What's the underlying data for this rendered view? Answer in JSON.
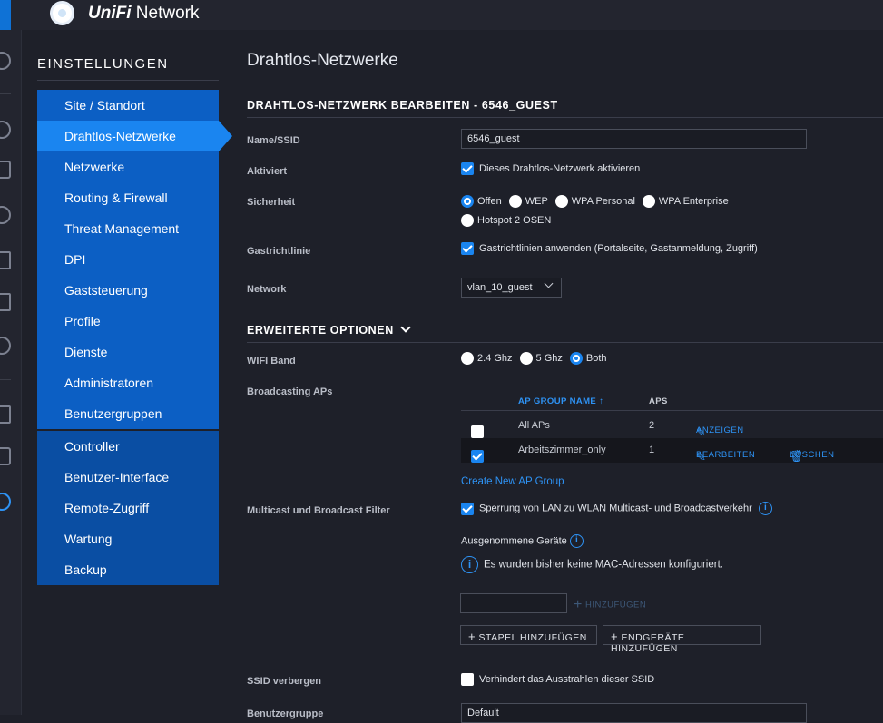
{
  "app": {
    "brand": "UniFi",
    "product": "Network"
  },
  "settings_nav": {
    "heading": "EINSTELLUNGEN",
    "items": [
      "Site / Standort",
      "Drahtlos-Netzwerke",
      "Netzwerke",
      "Routing & Firewall",
      "Threat Management",
      "DPI",
      "Gaststeuerung",
      "Profile",
      "Dienste",
      "Administratoren",
      "Benutzergruppen"
    ],
    "items2": [
      "Controller",
      "Benutzer-Interface",
      "Remote-Zugriff",
      "Wartung",
      "Backup"
    ],
    "active_index": 1
  },
  "page": {
    "title": "Drahtlos-Netzwerke",
    "section": "DRAHTLOS-NETZWERK BEARBEITEN - 6546_GUEST"
  },
  "form": {
    "ssid_label": "Name/SSID",
    "ssid_value": "6546_guest",
    "enabled_label": "Aktiviert",
    "enabled_text": "Dieses Drahtlos-Netzwerk aktivieren",
    "enabled": true,
    "security_label": "Sicherheit",
    "security_options": [
      "Offen",
      "WEP",
      "WPA Personal",
      "WPA Enterprise",
      "Hotspot 2 OSEN"
    ],
    "security_selected": "Offen",
    "guest_label": "Gastrichtlinie",
    "guest_text": "Gastrichtlinien anwenden (Portalseite, Gastanmeldung, Zugriff)",
    "guest": true,
    "network_label": "Network",
    "network_value": "vlan_10_guest"
  },
  "advanced": {
    "heading": "ERWEITERTE OPTIONEN",
    "wifi_band_label": "WIFI Band",
    "wifi_band_options": [
      "2.4 Ghz",
      "5 Ghz",
      "Both"
    ],
    "wifi_band_selected": "Both",
    "broadcasting_label": "Broadcasting APs",
    "table": {
      "col_name": "AP GROUP NAME",
      "col_aps": "APS",
      "rows": [
        {
          "name": "All APs",
          "aps": "2",
          "checked": false,
          "action1": "ANZEIGEN"
        },
        {
          "name": "Arbeitszimmer_only",
          "aps": "1",
          "checked": true,
          "action1": "BEARBEITEN",
          "action2": "LÖSCHEN"
        }
      ]
    },
    "create_group": "Create New AP Group",
    "multicast_label": "Multicast und Broadcast Filter",
    "multicast_text": "Sperrung von LAN zu WLAN Multicast- und Broadcastverkehr",
    "multicast": true,
    "excluded_label": "Ausgenommene Geräte",
    "excluded_info": "Es wurden bisher keine MAC-Adressen konfiguriert.",
    "add_label": "HINZUFÜGEN",
    "bulk_add": "STAPEL HINZUFÜGEN",
    "add_device": "ENDGERÄTE HINZUFÜGEN",
    "hide_ssid_label": "SSID verbergen",
    "hide_ssid_text": "Verhindert das Ausstrahlen dieser SSID",
    "hide_ssid": false,
    "usergroup_label": "Benutzergruppe",
    "usergroup_value": "Default"
  }
}
